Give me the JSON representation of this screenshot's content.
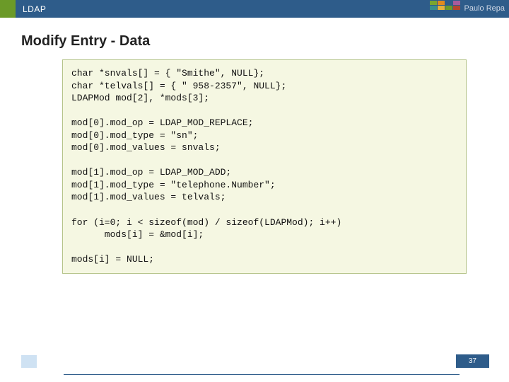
{
  "header": {
    "title": "LDAP",
    "author": "Paulo Repa"
  },
  "palette": [
    "#7aa52f",
    "#e08a1e",
    "#2e5c8a",
    "#a85a9c",
    "#3a8e8a",
    "#e6b23a",
    "#6b9a28",
    "#b5452e"
  ],
  "slide": {
    "title": "Modify Entry - Data",
    "code": "char *snvals[] = { \"Smithe\", NULL};\nchar *telvals[] = { \" 958-2357\", NULL};\nLDAPMod mod[2], *mods[3];\n\nmod[0].mod_op = LDAP_MOD_REPLACE;\nmod[0].mod_type = \"sn\";\nmod[0].mod_values = snvals;\n\nmod[1].mod_op = LDAP_MOD_ADD;\nmod[1].mod_type = \"telephone.Number\";\nmod[1].mod_values = telvals;\n\nfor (i=0; i < sizeof(mod) / sizeof(LDAPMod); i++)\n      mods[i] = &mod[i];\n\nmods[i] = NULL;"
  },
  "footer": {
    "slideNumber": "37"
  }
}
